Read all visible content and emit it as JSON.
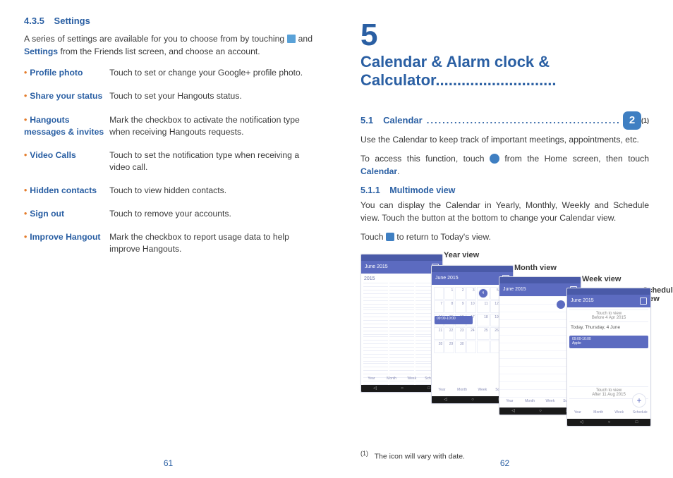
{
  "left": {
    "section_num": "4.3.5",
    "section_title": "Settings",
    "intro_a": "A series of settings are available for you to choose from by touching ",
    "intro_b": " and ",
    "intro_bold": "Settings",
    "intro_c": " from the Friends list screen, and choose an account.",
    "rows": [
      {
        "term": "Profile photo",
        "desc": "Touch to set or change your Google+ profile photo."
      },
      {
        "term": "Share your status",
        "desc": "Touch to set your Hangouts status."
      },
      {
        "term": "Hangouts messages & invites",
        "desc": "Mark the checkbox to activate the notification type when receiving Hangouts requests."
      },
      {
        "term": "Video Calls",
        "desc": "Touch to set the notification type when receiving a video call."
      },
      {
        "term": "Hidden contacts",
        "desc": "Touch to view hidden contacts."
      },
      {
        "term": "Sign out",
        "desc": "Touch to remove your accounts."
      },
      {
        "term": "Improve Hangout",
        "desc": "Mark the checkbox to report usage data to help improve Hangouts."
      }
    ],
    "page": "61"
  },
  "right": {
    "chapter_num": "5",
    "chapter_title": "Calendar & Alarm clock & Calculator............................",
    "sec_num": "5.1",
    "sec_title": "Calendar",
    "date_badge": "2",
    "sup": "(1)",
    "p1": "Use the Calendar to keep track of important meetings, appointments, etc.",
    "p2a": "To access this function, touch ",
    "p2b": " from the Home screen, then touch ",
    "p2bold": "Calendar",
    "p2c": ".",
    "sub_num": "5.1.1",
    "sub_title": "Multimode view",
    "p3": "You can display the Calendar in Yearly, Monthly, Weekly and Schedule view. Touch the button at the bottom to change your Calendar view.",
    "p4a": "Touch ",
    "p4b": " to return to Today's view.",
    "labels": {
      "year": "Year view",
      "month": "Month view",
      "week": "Week view",
      "schedule": "Schedule view"
    },
    "appbar": "June 2015",
    "tabs": {
      "y": "Year",
      "m": "Month",
      "w": "Week",
      "s": "Schedule"
    },
    "schedule": {
      "before": "Touch to view",
      "before2": "Before 4 Apr 2015",
      "today": "Today, Thursday, 4 June",
      "after": "Touch to view",
      "after2": "After 11 Aug 2015"
    },
    "footnote_mark": "(1)",
    "footnote": "The icon will vary with date.",
    "page": "62"
  }
}
